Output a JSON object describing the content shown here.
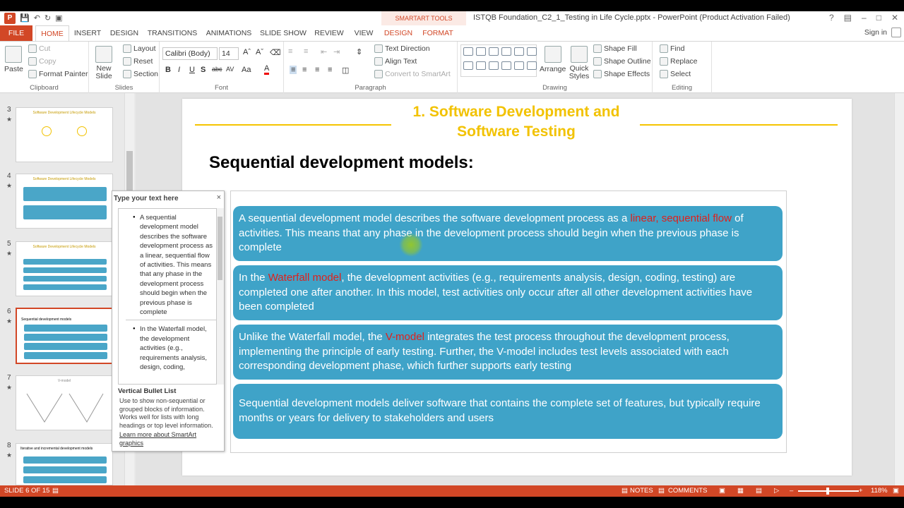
{
  "window": {
    "title": "ISTQB Foundation_C2_1_Testing in Life Cycle.pptx - PowerPoint (Product Activation Failed)",
    "context_tab_group": "SMARTART TOOLS",
    "help": "?",
    "minimize": "–",
    "restore": "□",
    "close": "✕",
    "app_icon": "P"
  },
  "tabs": [
    "FILE",
    "HOME",
    "INSERT",
    "DESIGN",
    "TRANSITIONS",
    "ANIMATIONS",
    "SLIDE SHOW",
    "REVIEW",
    "VIEW",
    "DESIGN",
    "FORMAT"
  ],
  "active_tab": "HOME",
  "signin": "Sign in",
  "ribbon": {
    "clipboard": {
      "paste": "Paste",
      "cut": "Cut",
      "copy": "Copy",
      "format_painter": "Format Painter",
      "label": "Clipboard"
    },
    "slides": {
      "new_slide": "New Slide",
      "layout": "Layout",
      "reset": "Reset",
      "section": "Section",
      "label": "Slides"
    },
    "font": {
      "font_name": "Calibri (Body)",
      "font_size": "14",
      "label": "Font",
      "bold": "B",
      "italic": "I",
      "underline": "U",
      "shadow": "S",
      "strike": "abc",
      "spacing": "AV",
      "case": "Aa",
      "color": "A"
    },
    "paragraph": {
      "text_direction": "Text Direction",
      "align_text": "Align Text",
      "convert": "Convert to SmartArt",
      "label": "Paragraph"
    },
    "drawing": {
      "arrange": "Arrange",
      "quick_styles": "Quick Styles",
      "shape_fill": "Shape Fill",
      "shape_outline": "Shape Outline",
      "shape_effects": "Shape Effects",
      "label": "Drawing"
    },
    "editing": {
      "find": "Find",
      "replace": "Replace",
      "select": "Select",
      "label": "Editing"
    }
  },
  "thumbnails": [
    {
      "num": "3",
      "title": "Software Development Lifecycle Models"
    },
    {
      "num": "4",
      "title": "Software Development Lifecycle Models"
    },
    {
      "num": "5",
      "title": "Software Development Lifecycle Models"
    },
    {
      "num": "6",
      "title": "Sequential development models"
    },
    {
      "num": "7",
      "title": "V-model"
    },
    {
      "num": "8",
      "title": "Iterative and incremental development models"
    }
  ],
  "slide": {
    "title_line1": "1. Software Development and",
    "title_line2": "Software Testing",
    "heading": "Sequential development models:",
    "blocks": [
      {
        "pre": "A sequential development model describes the software development process as a ",
        "hl": "linear, sequential flow",
        "post": " of activities. This means that any phase in the development process should begin when the previous phase is complete"
      },
      {
        "pre": "In the ",
        "hl": "Waterfall model",
        "post": ", the development activities (e.g., requirements analysis, design, coding, testing) are completed one after another. In this model, test activities only occur after all other development activities have been completed"
      },
      {
        "pre": "Unlike the Waterfall model, the ",
        "hl": "V-model",
        "post": " integrates the test process throughout the development process, implementing the principle of early testing. Further, the V-model includes test levels associated with each corresponding development phase, which further supports early testing"
      },
      {
        "pre": "Sequential development models deliver software that contains the complete set of features, but typically require months or years for delivery to stakeholders and users",
        "hl": "",
        "post": ""
      }
    ]
  },
  "text_pane": {
    "title": "Type your text here",
    "close": "×",
    "items": [
      "A sequential development model describes the software development process as a linear, sequential flow of activities. This means that any phase in the development process should begin when the previous phase is complete",
      "In the Waterfall model, the development activities (e.g., requirements analysis, design, coding,"
    ],
    "layout_name": "Vertical Bullet List",
    "layout_desc": "Use to show non-sequential or grouped blocks of information. Works well for lists with long headings or top level information.",
    "learn_more": "Learn more about SmartArt graphics"
  },
  "statusbar": {
    "slide_info": "SLIDE 6 OF 15",
    "notes": "NOTES",
    "comments": "COMMENTS",
    "zoom": "118%"
  },
  "colors": {
    "accent": "#d24726",
    "block": "#3fa3c8",
    "title": "#f2c200",
    "highlight": "#e0201b"
  }
}
